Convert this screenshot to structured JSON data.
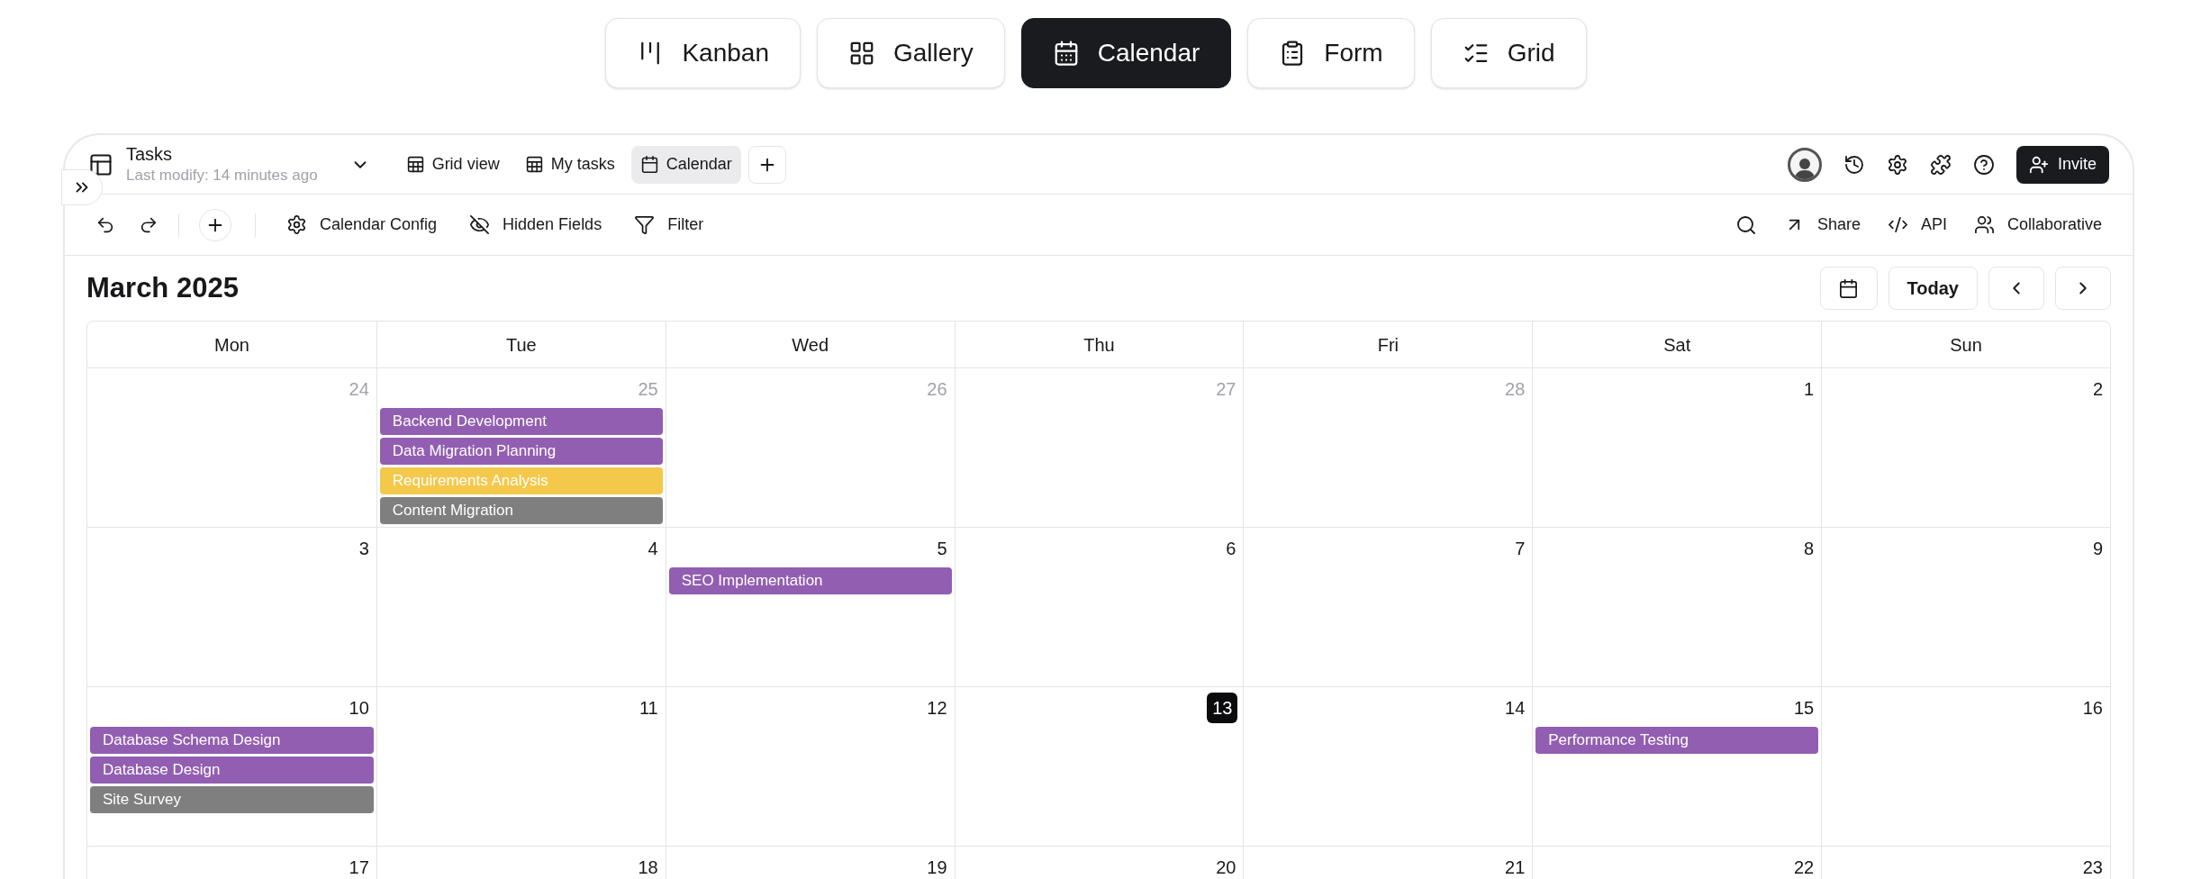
{
  "view_switcher": [
    {
      "label": "Kanban",
      "kind": "kanban",
      "selected": false
    },
    {
      "label": "Gallery",
      "kind": "gallery",
      "selected": false
    },
    {
      "label": "Calendar",
      "kind": "calendar",
      "selected": true
    },
    {
      "label": "Form",
      "kind": "form",
      "selected": false
    },
    {
      "label": "Grid",
      "kind": "grid",
      "selected": false
    }
  ],
  "table": {
    "title": "Tasks",
    "subtitle": "Last modify: 14 minutes ago"
  },
  "views": [
    {
      "label": "Grid view",
      "kind": "grid",
      "selected": false
    },
    {
      "label": "My tasks",
      "kind": "grid",
      "selected": false
    },
    {
      "label": "Calendar",
      "kind": "calendar",
      "selected": true
    }
  ],
  "invite_button": "Invite",
  "toolbar_left": [
    {
      "label": "Calendar Config",
      "kind": "settings"
    },
    {
      "label": "Hidden Fields",
      "kind": "hidden"
    },
    {
      "label": "Filter",
      "kind": "filter"
    }
  ],
  "toolbar_right": [
    {
      "label": "Share",
      "kind": "share"
    },
    {
      "label": "API",
      "kind": "code"
    },
    {
      "label": "Collaborative",
      "kind": "users"
    }
  ],
  "calendar": {
    "month": "March 2025",
    "today_button": "Today",
    "weekdays": [
      "Mon",
      "Tue",
      "Wed",
      "Thu",
      "Fri",
      "Sat",
      "Sun"
    ],
    "weeks": [
      {
        "days": [
          {
            "date": "24",
            "outside_month": true,
            "today": false
          },
          {
            "date": "25",
            "outside_month": true,
            "today": false,
            "events": [
              {
                "title": "Backend Development",
                "color": "#925eb1"
              },
              {
                "title": "Data Migration Planning",
                "color": "#925eb1"
              },
              {
                "title": "Requirements Analysis",
                "color": "#f4c84a"
              },
              {
                "title": "Content Migration",
                "color": "#7f7f7f"
              }
            ]
          },
          {
            "date": "26",
            "outside_month": true,
            "today": false
          },
          {
            "date": "27",
            "outside_month": true,
            "today": false
          },
          {
            "date": "28",
            "outside_month": true,
            "today": false
          },
          {
            "date": "1",
            "outside_month": false,
            "today": false
          },
          {
            "date": "2",
            "outside_month": false,
            "today": false
          }
        ]
      },
      {
        "days": [
          {
            "date": "3",
            "outside_month": false,
            "today": false
          },
          {
            "date": "4",
            "outside_month": false,
            "today": false
          },
          {
            "date": "5",
            "outside_month": false,
            "today": false,
            "events": [
              {
                "title": "SEO Implementation",
                "color": "#925eb1"
              }
            ]
          },
          {
            "date": "6",
            "outside_month": false,
            "today": false
          },
          {
            "date": "7",
            "outside_month": false,
            "today": false
          },
          {
            "date": "8",
            "outside_month": false,
            "today": false
          },
          {
            "date": "9",
            "outside_month": false,
            "today": false
          }
        ]
      },
      {
        "days": [
          {
            "date": "10",
            "outside_month": false,
            "today": false,
            "events": [
              {
                "title": "Database Schema Design",
                "color": "#925eb1"
              },
              {
                "title": "Database Design",
                "color": "#925eb1"
              },
              {
                "title": "Site Survey",
                "color": "#7f7f7f"
              }
            ]
          },
          {
            "date": "11",
            "outside_month": false,
            "today": false
          },
          {
            "date": "12",
            "outside_month": false,
            "today": false
          },
          {
            "date": "13",
            "outside_month": false,
            "today": true
          },
          {
            "date": "14",
            "outside_month": false,
            "today": false
          },
          {
            "date": "15",
            "outside_month": false,
            "today": false,
            "events": [
              {
                "title": "Performance Testing",
                "color": "#925eb1"
              }
            ]
          },
          {
            "date": "16",
            "outside_month": false,
            "today": false
          }
        ]
      },
      {
        "days": [
          {
            "date": "17",
            "outside_month": false,
            "today": false
          },
          {
            "date": "18",
            "outside_month": false,
            "today": false
          },
          {
            "date": "19",
            "outside_month": false,
            "today": false
          },
          {
            "date": "20",
            "outside_month": false,
            "today": false
          },
          {
            "date": "21",
            "outside_month": false,
            "today": false
          },
          {
            "date": "22",
            "outside_month": false,
            "today": false
          },
          {
            "date": "23",
            "outside_month": false,
            "today": false
          }
        ]
      }
    ]
  }
}
